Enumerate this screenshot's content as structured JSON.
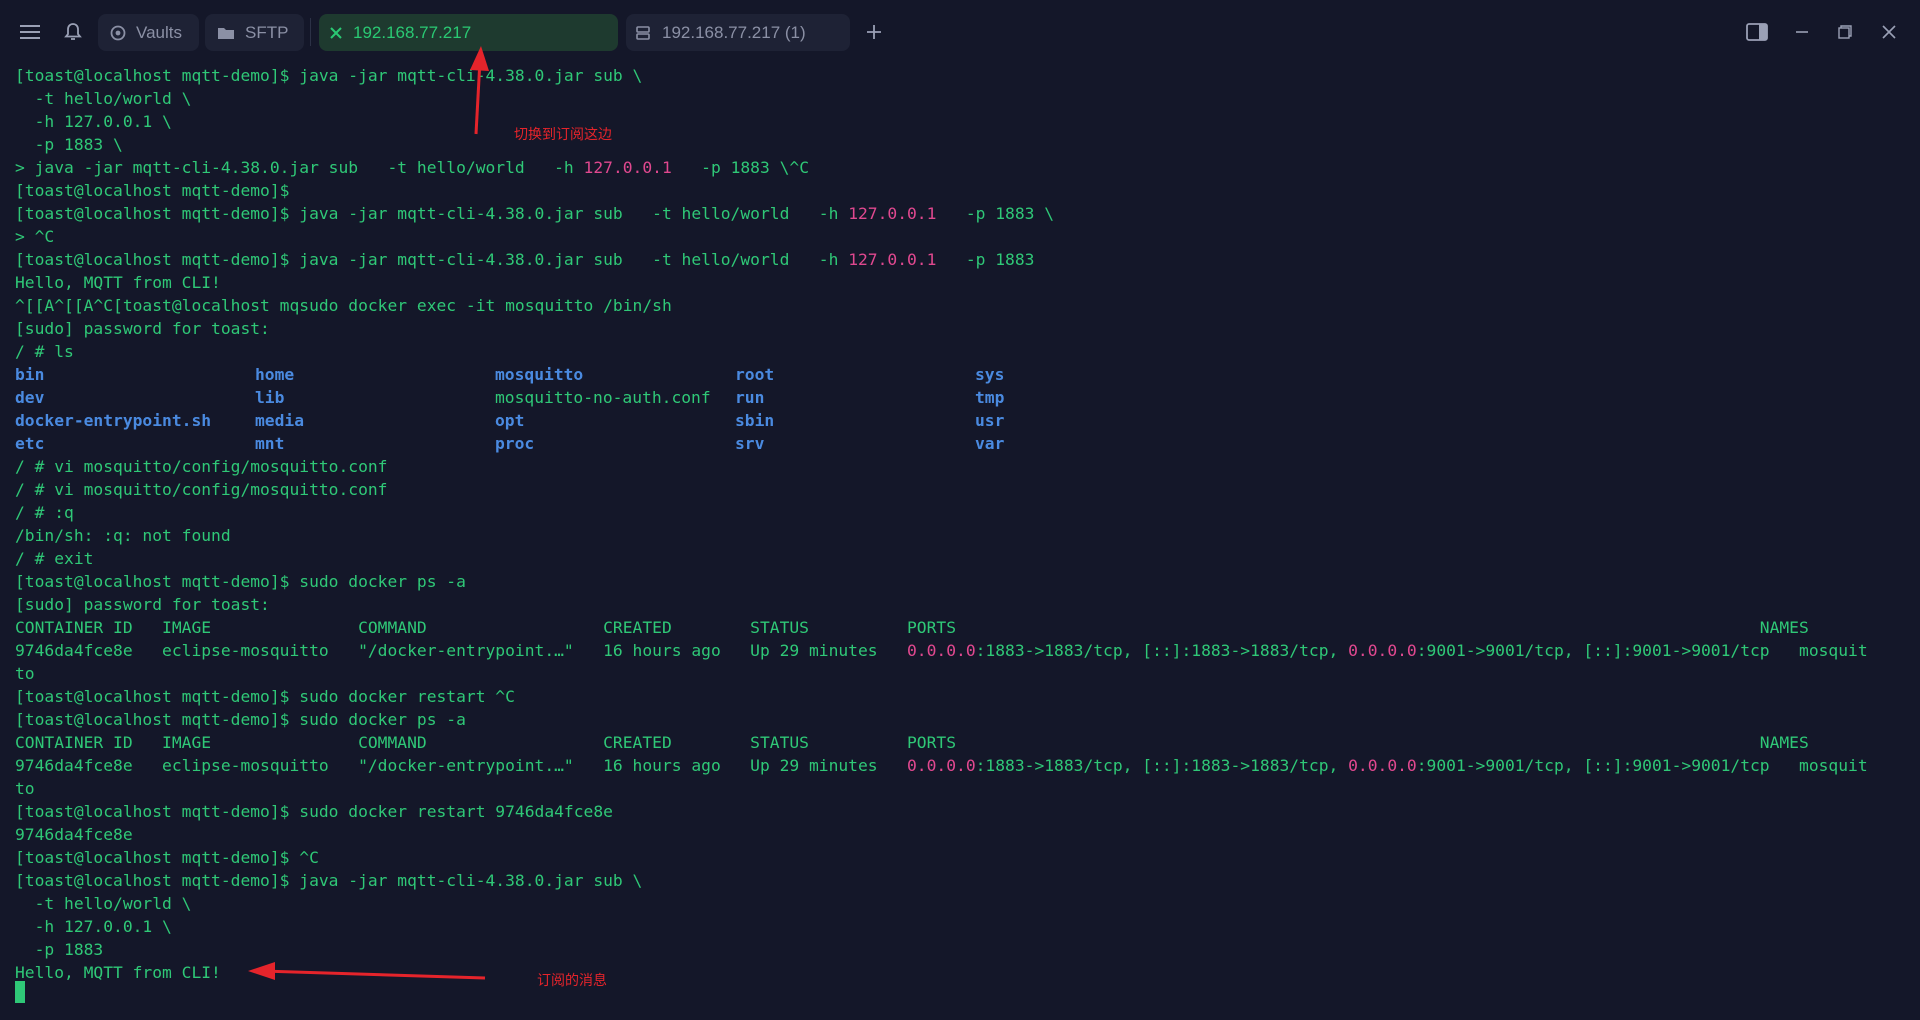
{
  "tabs": {
    "vaults_label": "Vaults",
    "sftp_label": "SFTP",
    "active_host": "192.168.77.217",
    "second_host": "192.168.77.217 (1)"
  },
  "colors": {
    "background": "#141729",
    "terminal_text": "#2fc877",
    "ip_highlight": "#e0488f",
    "dir_listing": "#4a8ae0",
    "active_tab": "#2ac973",
    "annotation": "#e5242b"
  },
  "terminal": {
    "l0": "[toast@localhost mqtt-demo]$ java -jar mqtt-cli-4.38.0.jar sub \\",
    "l1": "  -t hello/world \\",
    "l2": "  -h 127.0.0.1 \\",
    "l3": "  -p 1883 \\",
    "l4a": "> java -jar mqtt-cli-4.38.0.jar sub   -t hello/world   -h ",
    "l4b": "127.0.0.1",
    "l4c": "   -p 1883 \\^C",
    "l5": "[toast@localhost mqtt-demo]$",
    "l6a": "[toast@localhost mqtt-demo]$ java -jar mqtt-cli-4.38.0.jar sub   -t hello/world   -h ",
    "l6b": "127.0.0.1",
    "l6c": "   -p 1883 \\",
    "l7": "> ^C",
    "l8a": "[toast@localhost mqtt-demo]$ java -jar mqtt-cli-4.38.0.jar sub   -t hello/world   -h ",
    "l8b": "127.0.0.1",
    "l8c": "   -p 1883",
    "l9": "Hello, MQTT from CLI!",
    "l10": "^[[A^[[A^C[toast@localhost mqsudo docker exec -it mosquitto /bin/sh",
    "l11": "[sudo] password for toast:",
    "l12": "/ # ls",
    "ls_rows": [
      [
        "bin",
        "home",
        "mosquitto",
        "root",
        "sys"
      ],
      [
        "dev",
        "lib",
        "mosquitto-no-auth.conf",
        "run",
        "tmp"
      ],
      [
        "docker-entrypoint.sh",
        "media",
        "opt",
        "sbin",
        "usr"
      ],
      [
        "etc",
        "mnt",
        "proc",
        "srv",
        "var"
      ]
    ],
    "l17": "/ # vi mosquitto/config/mosquitto.conf",
    "l18": "/ # vi mosquitto/config/mosquitto.conf",
    "l19": "/ # :q",
    "l20": "/bin/sh: :q: not found",
    "l21": "/ # exit",
    "l22": "[toast@localhost mqtt-demo]$ sudo docker ps -a",
    "l23": "[sudo] password for toast:",
    "ps_header": "CONTAINER ID   IMAGE               COMMAND                  CREATED        STATUS          PORTS                                                                                  NAMES",
    "ps_row_a": "9746da4fce8e   eclipse-mosquitto   \"/docker-entrypoint.…\"   16 hours ago   Up 29 minutes   ",
    "ps_ip1": "0.0.0.0",
    "ps_row_b": ":1883->1883/tcp, [::]:1883->1883/tcp, ",
    "ps_ip2": "0.0.0.0",
    "ps_row_c": ":9001->9001/tcp, [::]:9001->9001/tcp   mosquit",
    "ps_wrap": "to",
    "l27": "[toast@localhost mqtt-demo]$ sudo docker restart ^C",
    "l28": "[toast@localhost mqtt-demo]$ sudo docker ps -a",
    "l32": "[toast@localhost mqtt-demo]$ sudo docker restart 9746da4fce8e",
    "l33": "9746da4fce8e",
    "l34": "[toast@localhost mqtt-demo]$ ^C",
    "l35": "[toast@localhost mqtt-demo]$ java -jar mqtt-cli-4.38.0.jar sub \\",
    "l36": "  -t hello/world \\",
    "l37": "  -h 127.0.0.1 \\",
    "l38": "  -p 1883",
    "l39": "Hello, MQTT from CLI!"
  },
  "annotations": {
    "switch_note": "切换到订阅这边",
    "message_note": "订阅的消息"
  }
}
